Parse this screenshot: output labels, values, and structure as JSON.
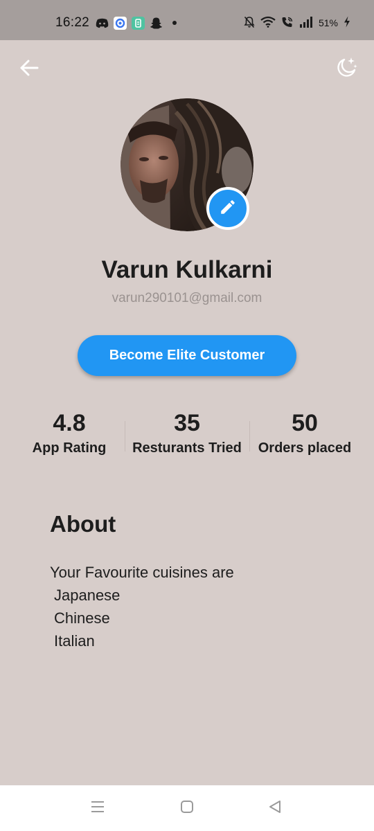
{
  "status_bar": {
    "time": "16:22",
    "battery": "51%",
    "icons": [
      "discord-icon",
      "signal-app-icon",
      "app-icon",
      "snapchat-icon",
      "notification-dot-icon",
      "mute-icon",
      "wifi-icon",
      "wifi-calling-icon",
      "signal-bars-icon",
      "charging-icon"
    ]
  },
  "header": {
    "back_icon": "arrow-left-icon",
    "theme_icon": "moon-stars-icon"
  },
  "profile": {
    "name": "Varun Kulkarni",
    "email": "varun290101@gmail.com",
    "edit_icon": "pencil-icon"
  },
  "elite_button": {
    "label": "Become Elite Customer"
  },
  "stats": [
    {
      "value": "4.8",
      "label": "App Rating"
    },
    {
      "value": "35",
      "label": "Resturants Tried"
    },
    {
      "value": "50",
      "label": "Orders placed"
    }
  ],
  "about": {
    "title": "About",
    "intro": "Your Favourite cuisines are",
    "cuisines": [
      "Japanese",
      "Chinese",
      "Italian"
    ]
  },
  "nav_bar": {
    "icons": [
      "menu-icon",
      "home-icon",
      "back-icon"
    ]
  },
  "colors": {
    "background": "#d7cdca",
    "status_bar": "#a59e9c",
    "accent": "#2196f3",
    "text": "#1d1d1d",
    "muted_text": "#9a9290"
  }
}
